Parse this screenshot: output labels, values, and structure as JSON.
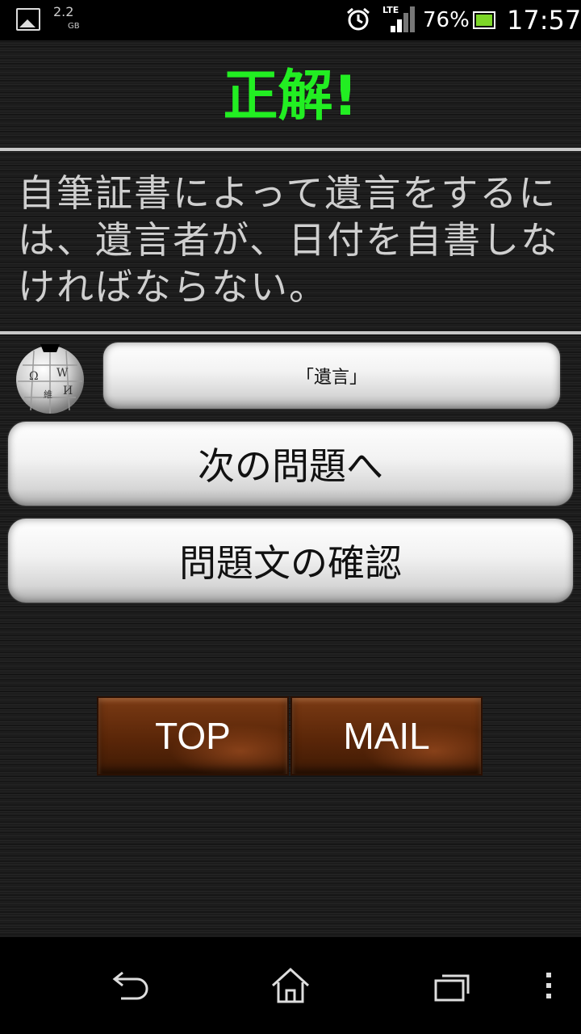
{
  "status_bar": {
    "storage": "2.2",
    "storage_unit": "GB",
    "network": "LTE",
    "battery_percent": "76%",
    "time": "17:57",
    "icons": [
      "image-notification-icon",
      "alarm-icon",
      "signal-icon",
      "battery-icon"
    ]
  },
  "result": {
    "title": "正解!",
    "title_color": "#22ee22"
  },
  "question": {
    "text": "自筆証書によって遺言をするには、遺言者が、日付を自書しなければならない。"
  },
  "reference": {
    "icon": "wikipedia-globe-icon",
    "term_label": "「遺言」"
  },
  "actions": {
    "next_label": "次の問題へ",
    "review_label": "問題文の確認"
  },
  "footer_buttons": {
    "top_label": "TOP",
    "mail_label": "MAIL"
  },
  "nav": {
    "icons": [
      "back-icon",
      "home-icon",
      "recent-apps-icon",
      "menu-icon"
    ]
  }
}
